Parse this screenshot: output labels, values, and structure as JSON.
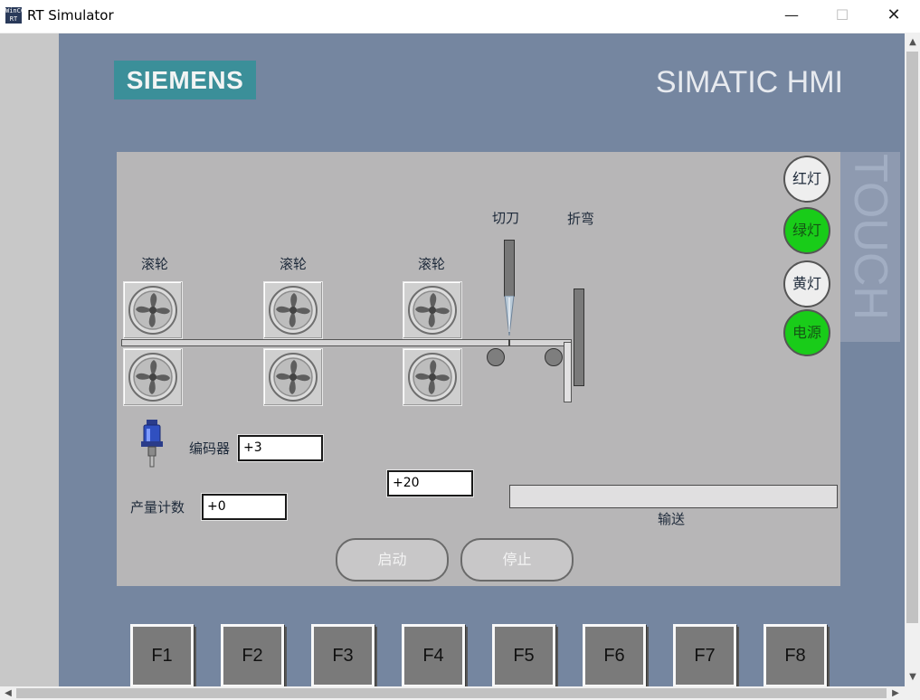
{
  "window": {
    "title": "RT Simulator",
    "icon": "wincc-app-icon",
    "icon_text": "WinCC RT"
  },
  "header": {
    "logo": "SIEMENS",
    "brand": "SIMATIC HMI",
    "touch": "TOUCH"
  },
  "machine": {
    "roller_label_1": "滚轮",
    "roller_label_2": "滚轮",
    "roller_label_3": "滚轮",
    "cutter_label": "切刀",
    "bend_label": "折弯"
  },
  "encoder": {
    "label": "编码器",
    "value": "+3"
  },
  "count": {
    "label": "产量计数",
    "value": "+0"
  },
  "position": {
    "value": "+20"
  },
  "conveyor": {
    "label": "输送"
  },
  "buttons": {
    "start": "启动",
    "stop": "停止"
  },
  "lamps": [
    {
      "label": "红灯",
      "state": "off"
    },
    {
      "label": "绿灯",
      "state": "on"
    },
    {
      "label": "黄灯",
      "state": "off"
    },
    {
      "label": "电源",
      "state": "on"
    }
  ],
  "fkeys": [
    "F1",
    "F2",
    "F3",
    "F4",
    "F5",
    "F6",
    "F7",
    "F8"
  ],
  "colors": {
    "panel": "#7586a0",
    "logo": "#3b8f99",
    "lamp_on": "#19cc19",
    "lamp_off": "#eeeeee",
    "screen": "#b7b6b7"
  }
}
